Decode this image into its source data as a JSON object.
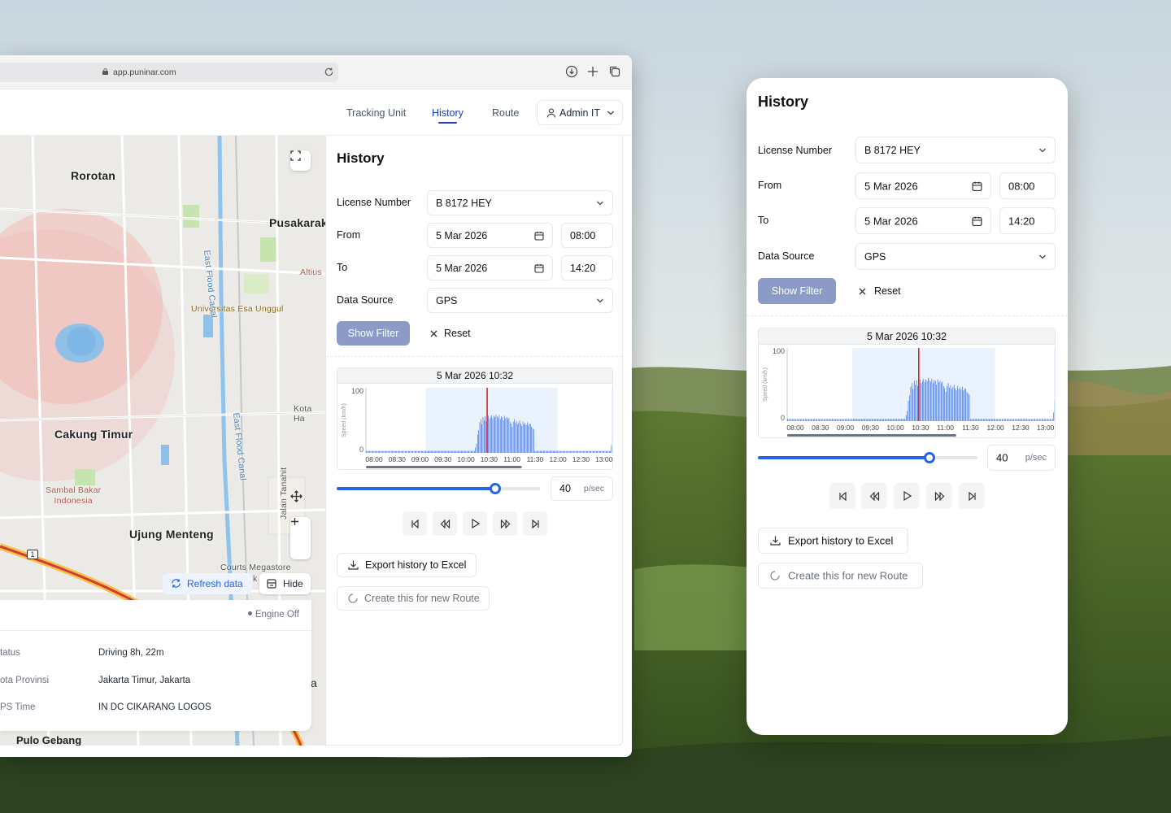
{
  "browser": {
    "url": "app.puninar.com"
  },
  "nav": {
    "items": [
      "Tracking Unit",
      "History",
      "Route"
    ],
    "active": "History",
    "user": "Admin IT"
  },
  "map": {
    "labels": {
      "rorotan": "Rorotan",
      "pusakarakyat": "Pusakaraky",
      "altius": "Altius",
      "university": "Universitas Esa Unggul",
      "kotaharapan": "Kota Ha",
      "eastfloodcanal": "East Flood Canal",
      "eastfloodcanal2": "East Flood Canal",
      "cakungtimur": "Cakung Timur",
      "sambal": "Sambal Bakar\nIndonesia",
      "jalantanahit": "Jalan Tanahit",
      "ujungmenteng": "Ujung Menteng",
      "courts": "Courts Megastore",
      "k": "k",
      "pulogebang": "Pulo Gebang",
      "a": "a",
      "roadnum": "1"
    },
    "refresh_label": "Refresh data",
    "hide_label": "Hide",
    "engine_status": "Engine Off",
    "info": [
      {
        "key": "tatus",
        "value": "Driving  8h, 22m"
      },
      {
        "key": "ota Provinsi",
        "value": "Jakarta Timur, Jakarta"
      },
      {
        "key": "PS Time",
        "value": "IN DC CIKARANG LOGOS"
      }
    ]
  },
  "history": {
    "title": "History",
    "license_label": "License Number",
    "license_value": "B 8172 HEY",
    "from_label": "From",
    "from_date": "5 Mar 2026",
    "from_time": "08:00",
    "to_label": "To",
    "to_date": "5 Mar 2026",
    "to_time": "14:20",
    "source_label": "Data Source",
    "source_value": "GPS",
    "show_filter": "Show Filter",
    "reset": "Reset",
    "speed_value": "40",
    "speed_unit": "p/sec",
    "slider_progress": 0.78,
    "export": "Export history to Excel",
    "create_route": "Create this for new Route"
  },
  "chart_data": {
    "type": "bar",
    "title": "5 Mar 2026 10:32",
    "ylabel": "Speed (km/h)",
    "ylim": [
      0,
      100
    ],
    "y_ticks": [
      "100",
      "0"
    ],
    "x_ticks": [
      "08:00",
      "08:30",
      "09:00",
      "09:30",
      "10:00",
      "10:30",
      "11:00",
      "11:30",
      "12:00",
      "12:30",
      "13:00"
    ],
    "x_range_minutes": [
      480,
      790
    ],
    "selected_range_minutes": [
      555,
      720
    ],
    "cursor_minutes": [
      632
    ],
    "series": [
      {
        "values": [
          3,
          3,
          3,
          3,
          3,
          3,
          3,
          3,
          3,
          3,
          3,
          3,
          3,
          3,
          3,
          3,
          3,
          3,
          3,
          3,
          3,
          3,
          3,
          3,
          3,
          3,
          3,
          3,
          3,
          3,
          3,
          3,
          3,
          3,
          3,
          3,
          3,
          3,
          3,
          3,
          3,
          3,
          3,
          3,
          3,
          3,
          3,
          3,
          3,
          3,
          3,
          3,
          3,
          3,
          3,
          3,
          3,
          3,
          3,
          3,
          3,
          3,
          3,
          3,
          3,
          3,
          3,
          3,
          3,
          3,
          3,
          3,
          3,
          3,
          3,
          3,
          3,
          3,
          3,
          3,
          3,
          3,
          3,
          3,
          3,
          3,
          3,
          3,
          3,
          3,
          3,
          3,
          3,
          3,
          3,
          3,
          3,
          3,
          3,
          3,
          3,
          8,
          14,
          28,
          35,
          47,
          52,
          44,
          55,
          50,
          56,
          48,
          54,
          57,
          52,
          55,
          58,
          53,
          57,
          55,
          59,
          56,
          54,
          58,
          52,
          56,
          55,
          50,
          57,
          53,
          55,
          52,
          54,
          48,
          45,
          40,
          48,
          52,
          46,
          49,
          44,
          47,
          50,
          45,
          42,
          48,
          44,
          46,
          43,
          47,
          42,
          45,
          44,
          40,
          38,
          36,
          3,
          3,
          3,
          3,
          3,
          3,
          3,
          3,
          3,
          3,
          3,
          3,
          3,
          3,
          3,
          3,
          3,
          3,
          3,
          3,
          3,
          3,
          3,
          3,
          3,
          3,
          3,
          3,
          3,
          3,
          3,
          3,
          3,
          3,
          3,
          3,
          3,
          3,
          3,
          3,
          3,
          3,
          3,
          3,
          3,
          3,
          3,
          3,
          3,
          3,
          3,
          3,
          3,
          3,
          3,
          3,
          3,
          3,
          3,
          3,
          3,
          3,
          3,
          3,
          3,
          3,
          3,
          3,
          3,
          3,
          3,
          12,
          28
        ]
      }
    ]
  }
}
